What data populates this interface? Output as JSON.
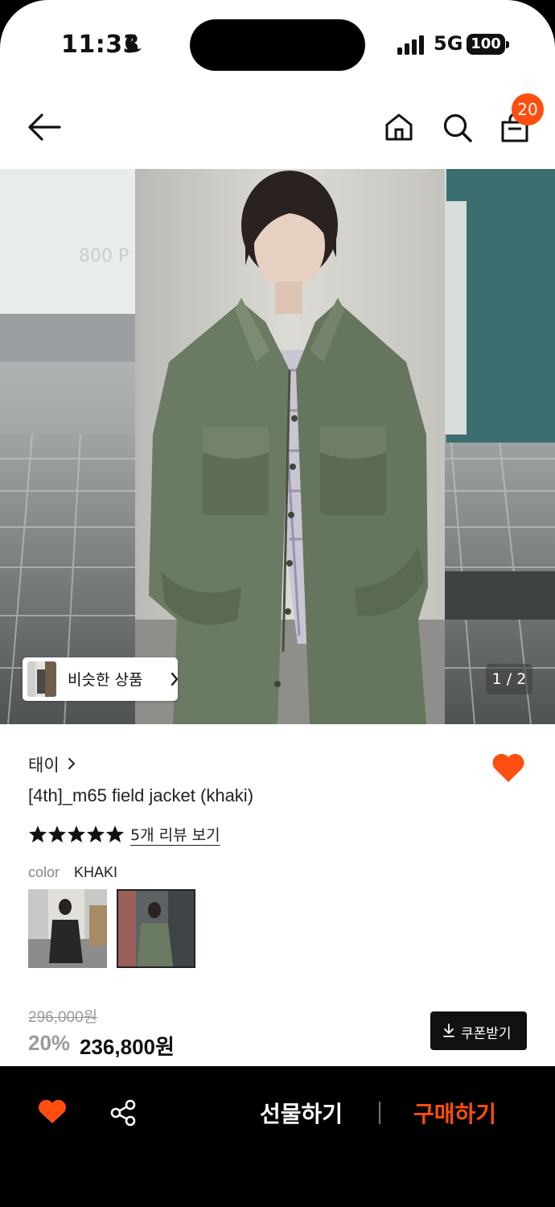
{
  "status_bar": {
    "time": "11:33",
    "network": "5G",
    "battery": "100"
  },
  "header": {
    "cart_count": "20"
  },
  "gallery": {
    "similar_label": "비슷한 상품",
    "page_indicator": "1 / 2"
  },
  "product": {
    "brand": "태이",
    "title": "[4th]_m65 field jacket (khaki)",
    "rating_stars": 5,
    "review_link": "5개 리뷰 보기",
    "color_label": "color",
    "color_value": "KHAKI",
    "original_price": "296,000원",
    "discount": "20%",
    "price": "236,800원",
    "coupon_label": "쿠폰받기"
  },
  "bottom_bar": {
    "gift_label": "선물하기",
    "buy_label": "구매하기"
  },
  "colors": {
    "accent": "#ff4e0f",
    "jacket": "#6b7a62",
    "bar": "#000000"
  },
  "icons": [
    "moon-icon",
    "signal-icon",
    "back-arrow-icon",
    "home-icon",
    "search-icon",
    "shopping-bag-icon",
    "chevron-right-icon",
    "heart-icon",
    "star-icon",
    "download-icon",
    "share-icon"
  ]
}
